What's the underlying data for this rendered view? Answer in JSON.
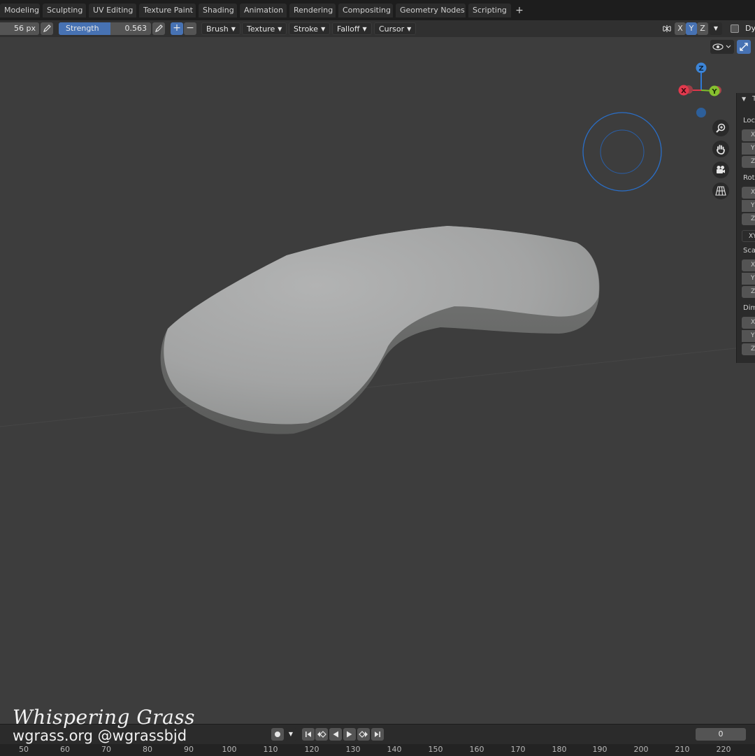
{
  "tabs": [
    "Modeling",
    "Sculpting",
    "UV Editing",
    "Texture Paint",
    "Shading",
    "Animation",
    "Rendering",
    "Compositing",
    "Geometry Nodes",
    "Scripting"
  ],
  "tab_add_label": "+",
  "toolbar": {
    "radius": "56 px",
    "strength_label": "Strength",
    "strength_value": "0.563",
    "strength_fraction": 0.563,
    "add_label": "+",
    "subtract_label": "−",
    "menus": [
      "Brush",
      "Texture",
      "Stroke",
      "Falloff",
      "Cursor"
    ],
    "axes": [
      "X",
      "Y",
      "Z"
    ],
    "active_axis": "Y",
    "dyntopo_label": "Dy"
  },
  "gizmo": {
    "z": "Z",
    "x": "X",
    "y": "Y"
  },
  "npanel": {
    "header": "T",
    "sections": [
      "Loc",
      "Rot",
      "Sca",
      "Dim"
    ],
    "row_letters": [
      "X",
      "Y",
      "Z"
    ],
    "rotation_mode": "XY"
  },
  "watermark": {
    "title": "Whispering Grass",
    "subtitle": "wgrass.org @wgrassbjd"
  },
  "timeline": {
    "current_frame": "0",
    "ruler_ticks": [
      "50",
      "60",
      "70",
      "80",
      "90",
      "100",
      "110",
      "120",
      "130",
      "140",
      "150",
      "160",
      "170",
      "180",
      "190",
      "200",
      "210",
      "220"
    ]
  },
  "icons": [
    "pen-pressure-icon",
    "transform-icon",
    "view-icon",
    "zoom-icon",
    "hand-icon",
    "camera-icon",
    "grid-icon",
    "record-icon",
    "jump-start-icon",
    "prev-keyframe-icon",
    "play-reverse-icon",
    "play-icon",
    "next-keyframe-icon",
    "jump-end-icon"
  ]
}
